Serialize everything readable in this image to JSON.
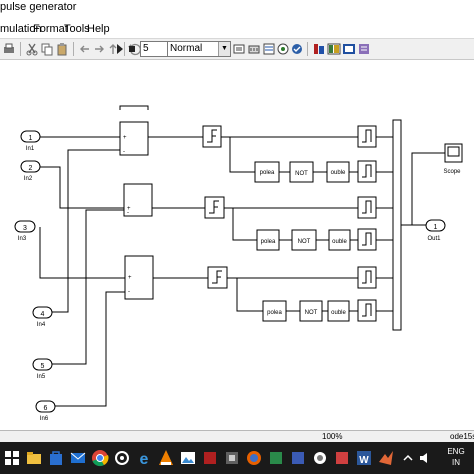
{
  "window": {
    "title": "pulse generator"
  },
  "menu": {
    "items": [
      "mulation",
      "Format",
      "Tools",
      "Help"
    ]
  },
  "toolbar": {
    "stop_time": "5",
    "sim_mode": "Normal"
  },
  "diagram": {
    "inports": [
      {
        "num": "1",
        "label": "In1"
      },
      {
        "num": "2",
        "label": "In2"
      },
      {
        "num": "3",
        "label": "In3"
      },
      {
        "num": "4",
        "label": "In4"
      },
      {
        "num": "5",
        "label": "In5"
      },
      {
        "num": "6",
        "label": "In6"
      }
    ],
    "sum_signs": [
      [
        "+",
        "-"
      ],
      [
        "+",
        "-"
      ],
      [
        "+",
        "-"
      ]
    ],
    "boolean_label": "polea",
    "not_label": "NOT",
    "double_label": "ouble",
    "scope_label": "Scope",
    "outport": {
      "num": "1",
      "label": "Out1"
    }
  },
  "status": {
    "zoom": "100%",
    "solver": "ode15s"
  },
  "taskbar": {
    "time": "ENG",
    "lang": "IN"
  }
}
